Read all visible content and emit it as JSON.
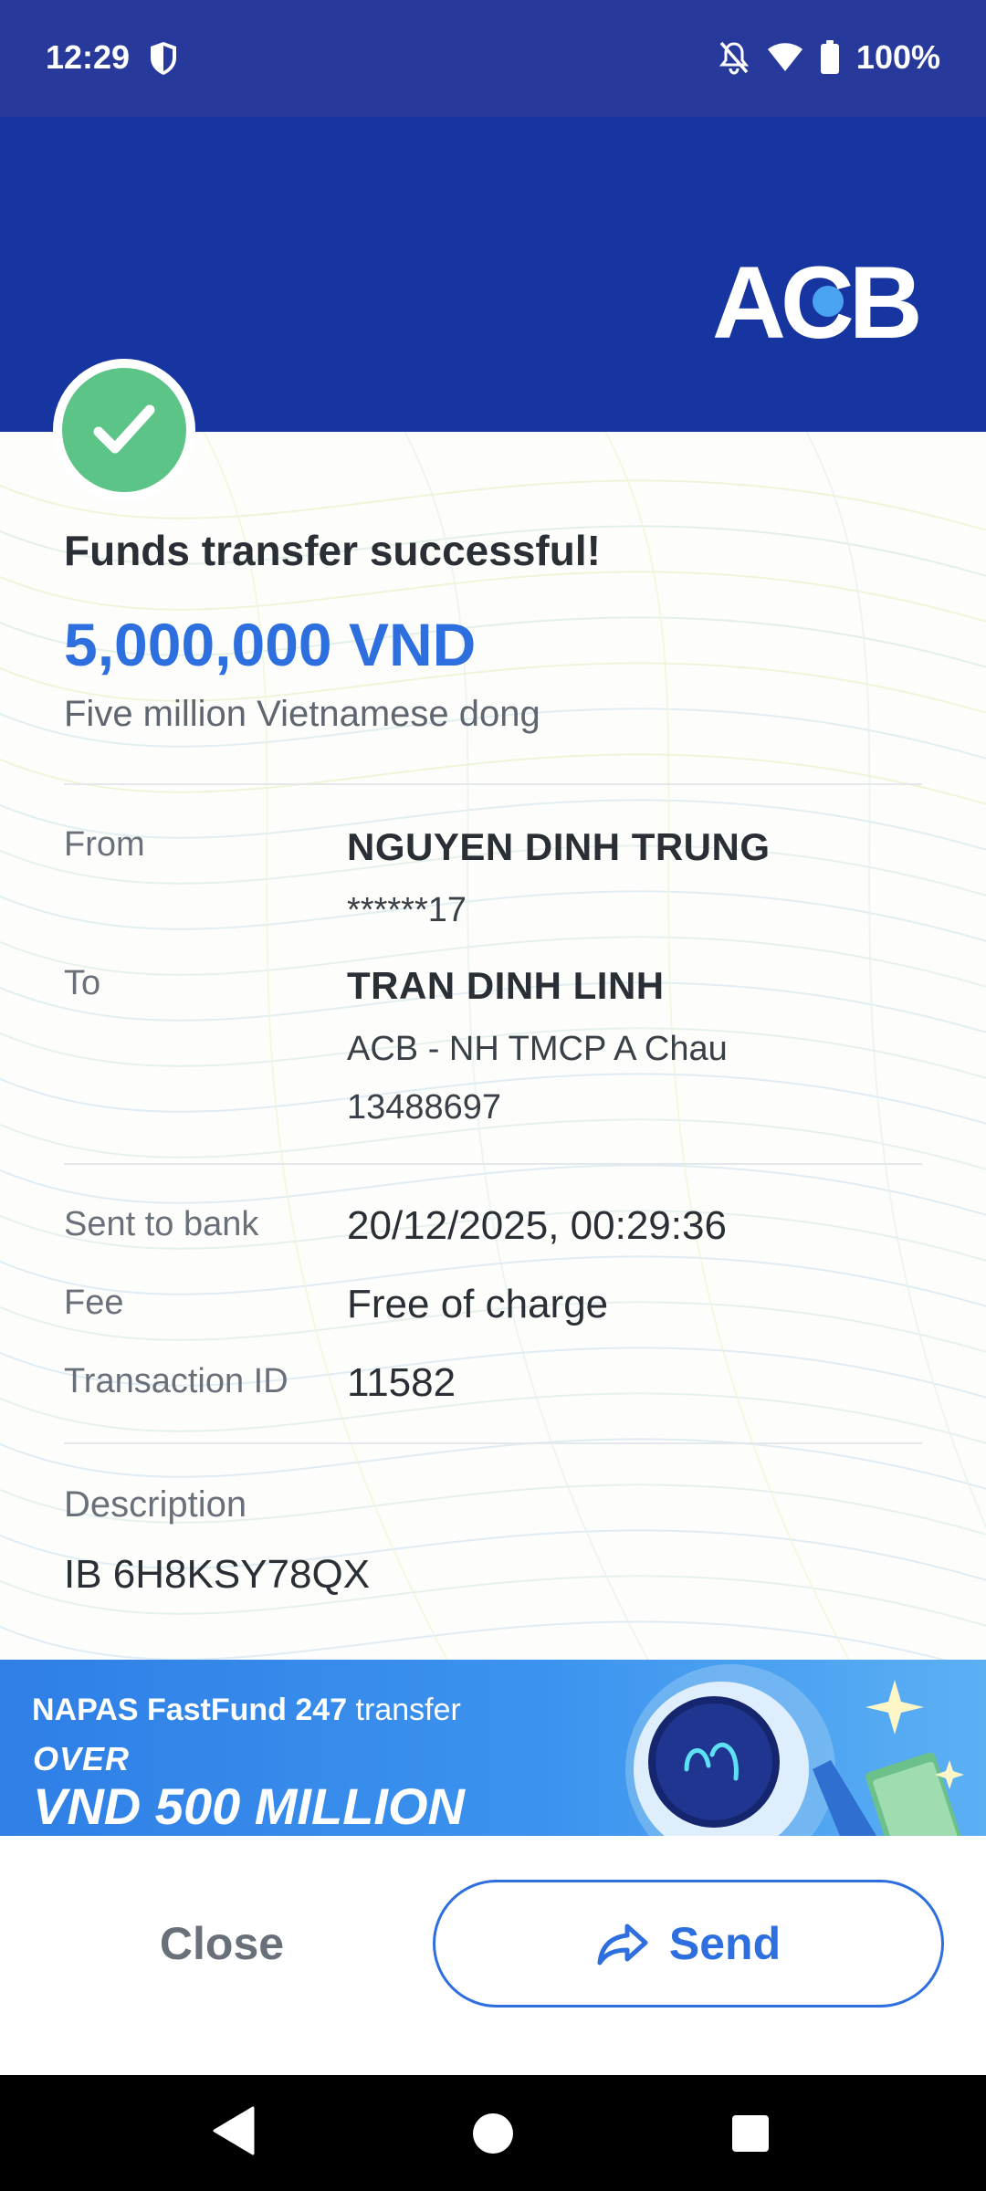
{
  "status_bar": {
    "time": "12:29",
    "battery": "100%",
    "icons": [
      "shield-icon",
      "notifications-off-icon",
      "wifi-icon",
      "battery-icon"
    ]
  },
  "brand": {
    "logo_text": "ACB"
  },
  "receipt": {
    "title": "Funds transfer successful!",
    "amount": "5,000,000 VND",
    "amount_words": "Five million Vietnamese dong",
    "from": {
      "label": "From",
      "name": "NGUYEN DINH TRUNG",
      "account": "******17"
    },
    "to": {
      "label": "To",
      "name": "TRAN DINH LINH",
      "bank": "ACB - NH TMCP A Chau",
      "account": "13488697"
    },
    "sent_to_bank": {
      "label": "Sent to bank",
      "value": "20/12/2025, 00:29:36"
    },
    "fee": {
      "label": "Fee",
      "value": "Free of charge"
    },
    "transaction_id": {
      "label": "Transaction ID",
      "value": "11582"
    },
    "description": {
      "label": "Description",
      "value": "IB 6H8KSY78QX"
    }
  },
  "promo": {
    "line1_bold": "NAPAS FastFund 247",
    "line1_rest": " transfer",
    "line2": "OVER",
    "line3": "VND 500 MILLION"
  },
  "actions": {
    "close_label": "Close",
    "send_label": "Send"
  },
  "colors": {
    "header": "#1735a0",
    "status_bar": "#27399a",
    "accent": "#2e6fe0",
    "success": "#5cc487"
  }
}
